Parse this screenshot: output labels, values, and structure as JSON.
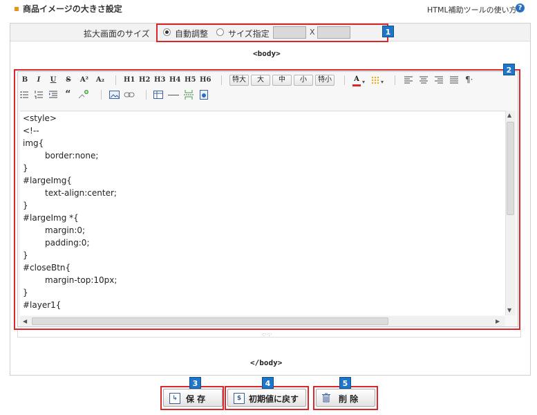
{
  "header": {
    "title": "商品イメージの大きさ設定",
    "help_link": "HTML補助ツールの使い方",
    "help_icon_glyph": "?"
  },
  "size_row": {
    "label": "拡大画面のサイズ",
    "radio_auto": "自動調整",
    "radio_custom": "サイズ指定",
    "selected": "auto",
    "width_value": "",
    "height_value": "",
    "times": "X"
  },
  "body_open": "<body>",
  "body_close": "</body>",
  "toolbar": {
    "row1": [
      "B",
      "I",
      "U",
      "S",
      "A²",
      "A₂",
      "H1",
      "H2",
      "H3",
      "H4",
      "H5",
      "H6"
    ],
    "size_buttons": [
      "特大",
      "大",
      "中",
      "小",
      "特小"
    ],
    "font_color_glyph": "A"
  },
  "code_lines": [
    "<style>",
    "<!--",
    "img{",
    "\tborder:none;",
    "}",
    "#largeImg{",
    "\ttext-align:center;",
    "}",
    "#largeImg *{",
    "\tmargin:0;",
    "\tpadding:0;",
    "}",
    "#closeBtn{",
    "\tmargin-top:10px;",
    "}",
    "#layer1{"
  ],
  "buttons": {
    "save": "保 存",
    "reset": "初期値に戻す",
    "delete": "削 除"
  },
  "badges": [
    "1",
    "2",
    "3",
    "4",
    "5"
  ],
  "colors": {
    "annotation_red": "#d9282c",
    "badge_blue": "#1f76c8",
    "title_bullet": "#e8941a"
  }
}
